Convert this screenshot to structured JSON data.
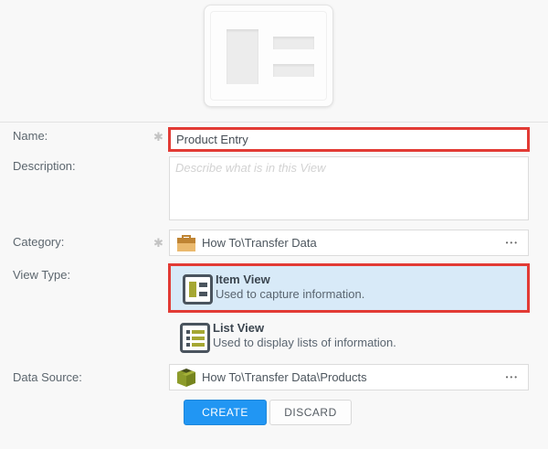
{
  "form": {
    "name": {
      "label": "Name:",
      "required": "✱",
      "value": "Product Entry"
    },
    "description": {
      "label": "Description:",
      "placeholder": "Describe what is in this View"
    },
    "category": {
      "label": "Category:",
      "required": "✱",
      "value": "How To\\Transfer Data",
      "more": "•••",
      "icon": "category-folder-icon"
    },
    "view_type": {
      "label": "View Type:",
      "options": [
        {
          "title": "Item View",
          "description": "Used to capture information.",
          "selected": true,
          "icon": "item-view-icon"
        },
        {
          "title": "List View",
          "description": "Used to display lists of information.",
          "selected": false,
          "icon": "list-view-icon"
        }
      ]
    },
    "data_source": {
      "label": "Data Source:",
      "value": "How To\\Transfer Data\\Products",
      "more": "•••",
      "icon": "data-source-cube-icon"
    }
  },
  "actions": {
    "create": "CREATE",
    "discard": "DISCARD"
  },
  "colors": {
    "highlight_border": "#e23b35",
    "selected_option_bg": "#d8eaf8",
    "create_button": "#2196f3",
    "folder_icon": "#eab96e",
    "cube_icon": "#8d9c2b",
    "olive_accent": "#a5a733"
  }
}
